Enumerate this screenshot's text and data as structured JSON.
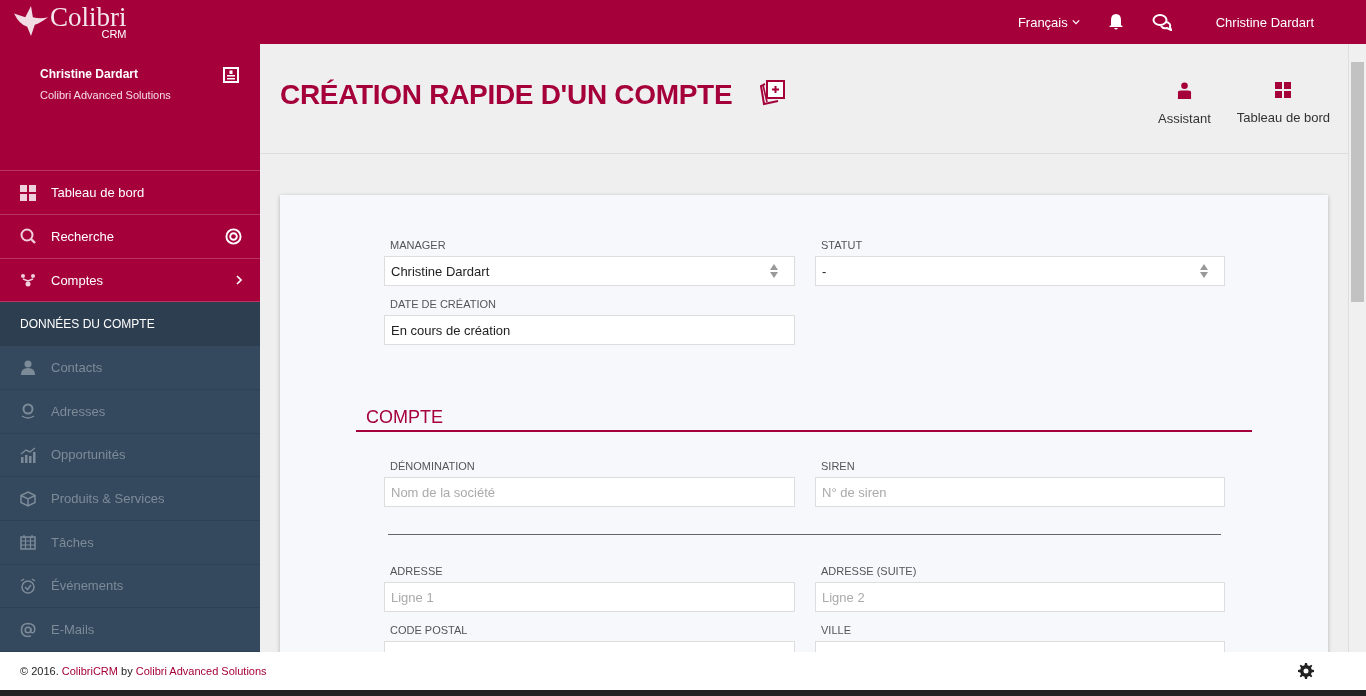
{
  "topbar": {
    "logo": "Colibri",
    "logo_sub": "CRM",
    "language": "Français",
    "user": "Christine Dardart"
  },
  "sidebar": {
    "user_name": "Christine Dardart",
    "company": "Colibri Advanced Solutions",
    "menu": [
      {
        "label": "Tableau de bord",
        "kind": "plain"
      },
      {
        "label": "Recherche",
        "kind": "badge"
      },
      {
        "label": "Comptes",
        "kind": "submenu"
      }
    ],
    "section": {
      "title": "DONNÉES DU COMPTE",
      "items": [
        {
          "label": "Contacts",
          "disabled": true
        },
        {
          "label": "Adresses",
          "disabled": true
        },
        {
          "label": "Opportunités",
          "disabled": true
        },
        {
          "label": "Produits & Services",
          "disabled": true
        },
        {
          "label": "Tâches",
          "disabled": true
        },
        {
          "label": "Événements",
          "disabled": true
        },
        {
          "label": "E-Mails",
          "disabled": true
        }
      ]
    }
  },
  "page": {
    "title": "CRÉATION RAPIDE D'UN COMPTE",
    "actions": [
      "Assistant",
      "Tableau de bord"
    ]
  },
  "form": {
    "top_fields": [
      {
        "label": "MANAGER",
        "kind": "select",
        "value": "Christine Dardart"
      },
      {
        "label": "STATUT",
        "kind": "select",
        "value": "-"
      },
      {
        "label": "DATE DE CRÉATION",
        "kind": "text",
        "value": "En cours de création"
      }
    ],
    "section_title": "COMPTE",
    "groups": [
      [
        {
          "label": "DÉNOMINATION",
          "placeholder": "Nom de la société"
        },
        {
          "label": "SIREN",
          "placeholder": "N° de siren"
        }
      ],
      [
        {
          "label": "ADRESSE",
          "placeholder": "Ligne 1"
        },
        {
          "label": "ADRESSE (SUITE)",
          "placeholder": "Ligne 2"
        },
        {
          "label": "CODE POSTAL"
        },
        {
          "label": "VILLE"
        }
      ]
    ]
  },
  "footer": {
    "prefix": "© 2016.",
    "link1": "ColibriCRM",
    "middle": "by",
    "link2": "Colibri Advanced Solutions"
  }
}
